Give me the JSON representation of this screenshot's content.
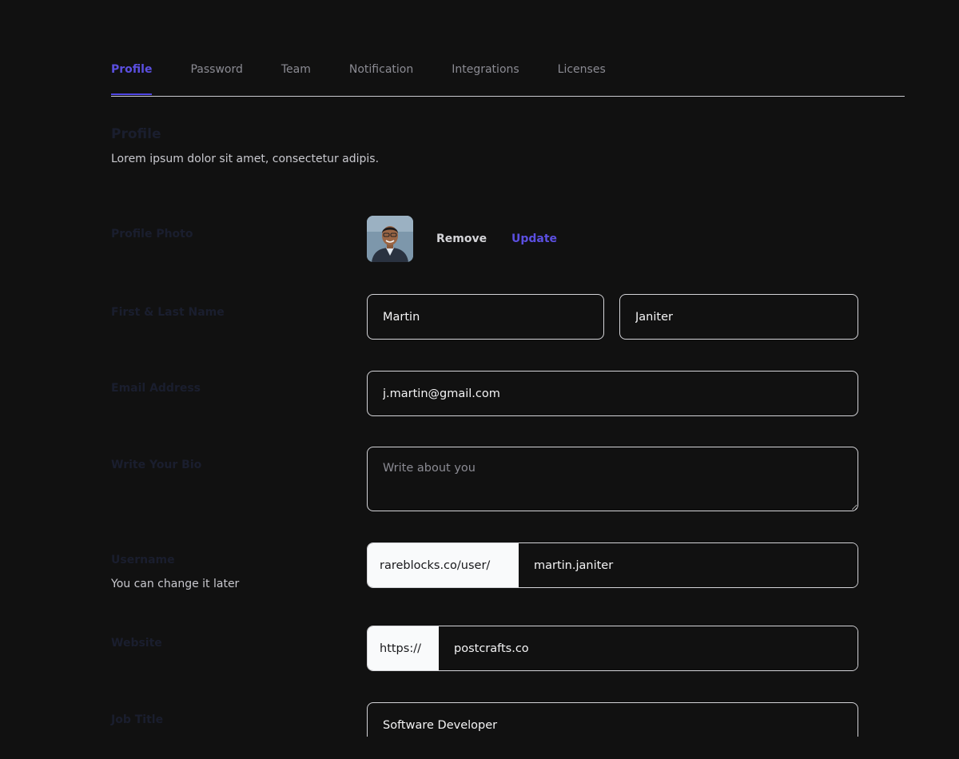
{
  "tabs": [
    {
      "label": "Profile",
      "active": true
    },
    {
      "label": "Password"
    },
    {
      "label": "Team"
    },
    {
      "label": "Notification"
    },
    {
      "label": "Integrations"
    },
    {
      "label": "Licenses"
    }
  ],
  "section": {
    "title": "Profile",
    "subtitle": "Lorem ipsum dolor sit amet, consectetur adipis."
  },
  "photo": {
    "label": "Profile Photo",
    "remove_label": "Remove",
    "update_label": "Update"
  },
  "name": {
    "label": "First & Last Name",
    "first": "Martin",
    "last": "Janiter"
  },
  "email": {
    "label": "Email Address",
    "value": "j.martin@gmail.com"
  },
  "bio": {
    "label": "Write Your Bio",
    "placeholder": "Write about you"
  },
  "username": {
    "label": "Username",
    "hint": "You can change it later",
    "prefix": "rareblocks.co/user/",
    "value": "martin.janiter"
  },
  "website": {
    "label": "Website",
    "prefix": "https://",
    "value": "postcrafts.co"
  },
  "job": {
    "label": "Job Title",
    "value": "Software Developer"
  },
  "colors": {
    "background": "#111111",
    "accent": "#4f46e5",
    "label_dim": "#1a1e2e",
    "border": "#d4d4d8"
  }
}
